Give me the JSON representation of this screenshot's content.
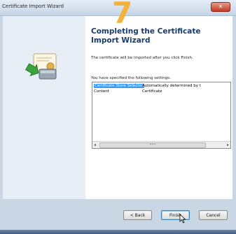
{
  "window": {
    "title": "Certificate Import Wizard",
    "close_label": "✕"
  },
  "overlay": {
    "step_number": "7"
  },
  "main": {
    "heading": "Completing the Certificate Import Wizard",
    "description": "The certificate will be imported after you click Finish.",
    "settings_label": "You have specified the following settings:",
    "settings": [
      {
        "setting": "Certificate Store Selected",
        "value": "Automatically determined by t"
      },
      {
        "setting": "Content",
        "value": "Certificate"
      }
    ],
    "scrollbar": {
      "left_arrow": "◂",
      "right_arrow": "▸",
      "thumb_grip": "•••"
    }
  },
  "buttons": {
    "back": "< Back",
    "finish": "Finish",
    "cancel": "Cancel"
  },
  "colors": {
    "selection": "#3399ff",
    "step_number": "#f5b23a",
    "heading": "#1a3a6a"
  },
  "icons": [
    "certificate-import-icon",
    "close-icon",
    "mouse-cursor-icon"
  ]
}
